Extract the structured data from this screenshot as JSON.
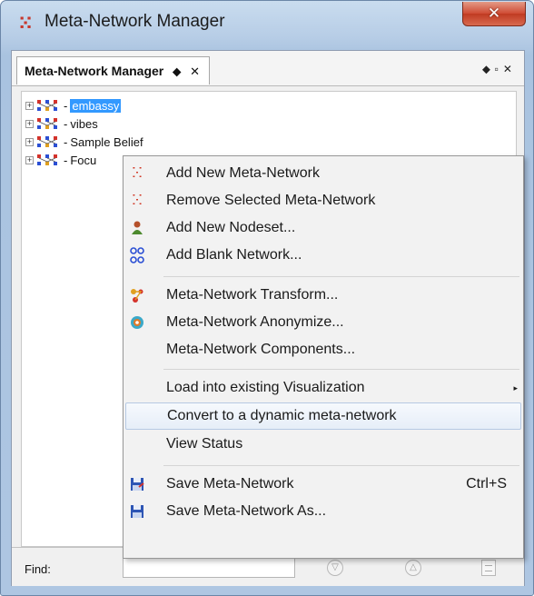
{
  "window": {
    "title": "Meta-Network Manager",
    "close_symbol": "✕",
    "icon": "network-app-icon"
  },
  "panel": {
    "tab_label": "Meta-Network Manager",
    "tab_pin": "⬥",
    "tab_close": "✕",
    "header_buttons": "⬥▫✕"
  },
  "tree": {
    "items": [
      {
        "label": "embassy",
        "selected": true
      },
      {
        "label": "vibes",
        "selected": false
      },
      {
        "label": "Sample Belief",
        "selected": false
      },
      {
        "label": "Focu",
        "selected": false
      }
    ],
    "expander": "+"
  },
  "findbar": {
    "label": "Find:",
    "value": ""
  },
  "context_menu": {
    "items": [
      {
        "label": "Add New Meta-Network",
        "icon": "add-metanetwork-icon",
        "shortcut": ""
      },
      {
        "label": "Remove Selected Meta-Network",
        "icon": "remove-metanetwork-icon",
        "shortcut": ""
      },
      {
        "label": "Add New Nodeset...",
        "icon": "add-nodeset-icon",
        "shortcut": ""
      },
      {
        "label": "Add Blank Network...",
        "icon": "add-network-icon",
        "shortcut": ""
      },
      {
        "label": "Meta-Network Transform...",
        "icon": "transform-icon",
        "shortcut": ""
      },
      {
        "label": "Meta-Network Anonymize...",
        "icon": "anonymize-icon",
        "shortcut": ""
      },
      {
        "label": "Meta-Network Components...",
        "icon": "",
        "shortcut": ""
      },
      {
        "label": "Load into existing Visualization",
        "icon": "",
        "shortcut": "",
        "submenu": true
      },
      {
        "label": "Convert to a dynamic meta-network",
        "icon": "",
        "shortcut": "",
        "hover": true
      },
      {
        "label": "View Status",
        "icon": "",
        "shortcut": ""
      },
      {
        "label": "Save Meta-Network",
        "icon": "save-icon",
        "shortcut": "Ctrl+S"
      },
      {
        "label": "Save Meta-Network As...",
        "icon": "save-as-icon",
        "shortcut": ""
      }
    ],
    "submenu_arrow": "▸"
  },
  "colors": {
    "selection": "#3399ff",
    "menu_hover_border": "#b6c9e3",
    "close_button": "#cf4b33"
  }
}
